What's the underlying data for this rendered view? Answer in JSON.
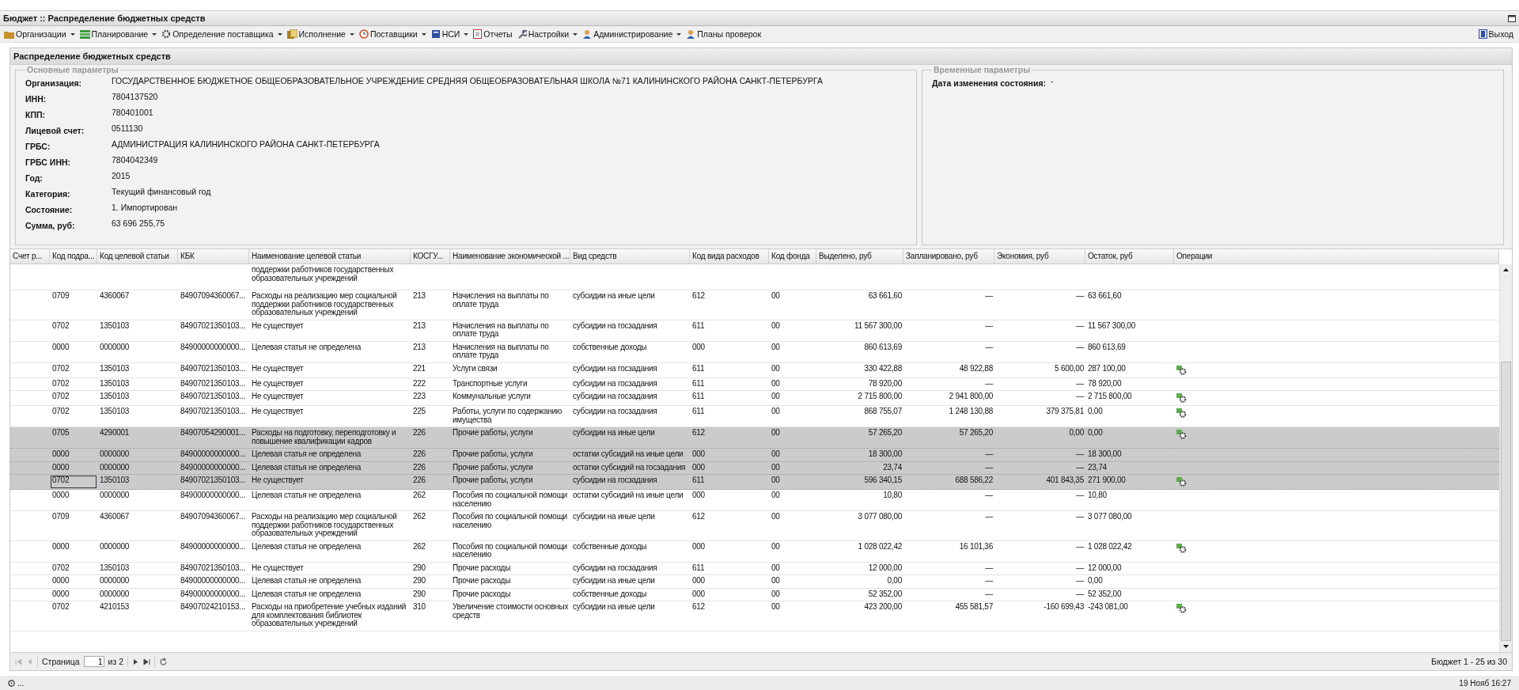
{
  "window": {
    "title": "Бюджет :: Распределение бюджетных средств"
  },
  "toolbar": [
    {
      "label": "Организации",
      "has_menu": true
    },
    {
      "label": "Планирование",
      "has_menu": true
    },
    {
      "label": "Определение поставщика",
      "has_menu": true
    },
    {
      "label": "Исполнение",
      "has_menu": true
    },
    {
      "label": "Поставщики",
      "has_menu": true
    },
    {
      "label": "НСИ",
      "has_menu": true
    },
    {
      "label": "Отчеты",
      "has_menu": false
    },
    {
      "label": "Настройки",
      "has_menu": true
    },
    {
      "label": "Администрирование",
      "has_menu": true
    },
    {
      "label": "Планы проверок",
      "has_menu": false
    }
  ],
  "exit_button": {
    "label": "Выход"
  },
  "panel": {
    "title": "Распределение бюджетных средств"
  },
  "main_params": {
    "legend": "Основные параметры",
    "fields": [
      {
        "label": "Организация:",
        "value": "ГОСУДАРСТВЕННОЕ БЮДЖЕТНОЕ ОБЩЕОБРАЗОВАТЕЛЬНОЕ УЧРЕЖДЕНИЕ СРЕДНЯЯ ОБЩЕОБРАЗОВАТЕЛЬНАЯ ШКОЛА №71 КАЛИНИНСКОГО РАЙОНА САНКТ-ПЕТЕРБУРГА"
      },
      {
        "label": "ИНН:",
        "value": "7804137520"
      },
      {
        "label": "КПП:",
        "value": "780401001"
      },
      {
        "label": "Лицевой счет:",
        "value": "0511130"
      },
      {
        "label": "ГРБС:",
        "value": "АДМИНИСТРАЦИЯ КАЛИНИНСКОГО РАЙОНА САНКТ-ПЕТЕРБУРГА"
      },
      {
        "label": "ГРБС ИНН:",
        "value": "7804042349"
      },
      {
        "label": "Год:",
        "value": "2015"
      },
      {
        "label": "Категория:",
        "value": "Текущий финансовый год"
      },
      {
        "label": "Состояние:",
        "value": "1. Импортирован"
      },
      {
        "label": "Сумма, руб:",
        "value": "63 696 255,75"
      }
    ]
  },
  "time_params": {
    "legend": "Временные параметры",
    "fields": [
      {
        "label": "Дата изменения состояния:",
        "value": "-"
      }
    ]
  },
  "table": {
    "columns": [
      "Счет р...",
      "Код подра...",
      "Код целевой статьи",
      "КБК",
      "Наименование целевой статьи",
      "КОСГУ...",
      "Наименование экономической ...",
      "Вид средств",
      "Код вида расходов",
      "Код фонда",
      "Выделено, руб",
      "Запланировано, руб",
      "Экономия, руб",
      "Остаток, руб",
      "Операции"
    ],
    "rows": [
      {
        "cells": [
          "",
          "",
          "",
          "",
          "поддержки работников государственных образовательных учреждений",
          "",
          "",
          "",
          "",
          "",
          "",
          "",
          "",
          "",
          ""
        ],
        "has_operation": false,
        "selected": false,
        "focused": false
      },
      {
        "cells": [
          "",
          "0709",
          "4360067",
          "84907094360067...",
          "Расходы на реализацию мер социальной поддержки работников государственных образовательных учреждений",
          "213",
          "Начисления на выплаты по оплате труда",
          "субсидии на иные цели",
          "612",
          "00",
          "63 661,60",
          "—",
          "—",
          "63 661,60"
        ],
        "has_operation": false,
        "selected": false,
        "focused": false
      },
      {
        "cells": [
          "",
          "0702",
          "1350103",
          "84907021350103...",
          "Не существует",
          "213",
          "Начисления на выплаты по оплате труда",
          "субсидии на госзадания",
          "611",
          "00",
          "11 567 300,00",
          "—",
          "—",
          "11 567 300,00"
        ],
        "has_operation": false,
        "selected": false,
        "focused": false
      },
      {
        "cells": [
          "",
          "0000",
          "0000000",
          "84900000000000...",
          "Целевая статья не определена",
          "213",
          "Начисления на выплаты по оплате труда",
          "собственные доходы",
          "000",
          "00",
          "860 613,69",
          "—",
          "—",
          "860 613,69"
        ],
        "has_operation": false,
        "selected": false,
        "focused": false
      },
      {
        "cells": [
          "",
          "0702",
          "1350103",
          "84907021350103...",
          "Не существует",
          "221",
          "Услуги связи",
          "субсидии на госзадания",
          "611",
          "00",
          "330 422,88",
          "48 922,88",
          "5 600,00",
          "287 100,00"
        ],
        "has_operation": true,
        "selected": false,
        "focused": false
      },
      {
        "cells": [
          "",
          "0702",
          "1350103",
          "84907021350103...",
          "Не существует",
          "222",
          "Транспортные услуги",
          "субсидии на госзадания",
          "611",
          "00",
          "78 920,00",
          "—",
          "—",
          "78 920,00"
        ],
        "has_operation": false,
        "selected": false,
        "focused": false
      },
      {
        "cells": [
          "",
          "0702",
          "1350103",
          "84907021350103...",
          "Не существует",
          "223",
          "Коммунальные услуги",
          "субсидии на госзадания",
          "611",
          "00",
          "2 715 800,00",
          "2 941 800,00",
          "—",
          "2 715 800,00"
        ],
        "has_operation": true,
        "selected": false,
        "focused": false
      },
      {
        "cells": [
          "",
          "0702",
          "1350103",
          "84907021350103...",
          "Не существует",
          "225",
          "Работы, услуги по содержанию имущества",
          "субсидии на госзадания",
          "611",
          "00",
          "868 755,07",
          "1 248 130,88",
          "379 375,81",
          "0,00"
        ],
        "has_operation": true,
        "selected": false,
        "focused": false
      },
      {
        "cells": [
          "",
          "0705",
          "4290001",
          "84907054290001...",
          "Расходы на подготовку, переподготовку и повышение квалификации кадров",
          "226",
          "Прочие работы, услуги",
          "субсидии на иные цели",
          "612",
          "00",
          "57 265,20",
          "57 265,20",
          "0,00",
          "0,00"
        ],
        "has_operation": true,
        "selected": true,
        "focused": false
      },
      {
        "cells": [
          "",
          "0000",
          "0000000",
          "84900000000000...",
          "Целевая статья не определена",
          "226",
          "Прочие работы, услуги",
          "остатки субсидий на иные цели",
          "000",
          "00",
          "18 300,00",
          "—",
          "—",
          "18 300,00"
        ],
        "has_operation": false,
        "selected": true,
        "focused": false
      },
      {
        "cells": [
          "",
          "0000",
          "0000000",
          "84900000000000...",
          "Целевая статья не определена",
          "226",
          "Прочие работы, услуги",
          "остатки субсидий на госзадания",
          "000",
          "00",
          "23,74",
          "—",
          "—",
          "23,74"
        ],
        "has_operation": false,
        "selected": true,
        "focused": false
      },
      {
        "cells": [
          "",
          "0702",
          "1350103",
          "84907021350103...",
          "Не существует",
          "226",
          "Прочие работы, услуги",
          "субсидии на госзадания",
          "611",
          "00",
          "596 340,15",
          "688 586,22",
          "401 843,35",
          "271 900,00"
        ],
        "has_operation": true,
        "selected": true,
        "focused": true
      },
      {
        "cells": [
          "",
          "0000",
          "0000000",
          "84900000000000...",
          "Целевая статья не определена",
          "262",
          "Пособия по социальной помощи населению",
          "остатки субсидий на иные цели",
          "000",
          "00",
          "10,80",
          "—",
          "—",
          "10,80"
        ],
        "has_operation": false,
        "selected": false,
        "focused": false
      },
      {
        "cells": [
          "",
          "0709",
          "4360067",
          "84907094360067...",
          "Расходы на реализацию мер социальной поддержки работников государственных образовательных учреждений",
          "262",
          "Пособия по социальной помощи населению",
          "субсидии на иные цели",
          "612",
          "00",
          "3 077 080,00",
          "—",
          "—",
          "3 077 080,00"
        ],
        "has_operation": false,
        "selected": false,
        "focused": false
      },
      {
        "cells": [
          "",
          "0000",
          "0000000",
          "84900000000000...",
          "Целевая статья не определена",
          "262",
          "Пособия по социальной помощи населению",
          "собственные доходы",
          "000",
          "00",
          "1 028 022,42",
          "16 101,36",
          "—",
          "1 028 022,42"
        ],
        "has_operation": true,
        "selected": false,
        "focused": false
      },
      {
        "cells": [
          "",
          "0702",
          "1350103",
          "84907021350103...",
          "Не существует",
          "290",
          "Прочие расходы",
          "субсидии на госзадания",
          "611",
          "00",
          "12 000,00",
          "—",
          "—",
          "12 000,00"
        ],
        "has_operation": false,
        "selected": false,
        "focused": false
      },
      {
        "cells": [
          "",
          "0000",
          "0000000",
          "84900000000000...",
          "Целевая статья не определена",
          "290",
          "Прочие расходы",
          "субсидии на иные цели",
          "000",
          "00",
          "0,00",
          "—",
          "—",
          "0,00"
        ],
        "has_operation": false,
        "selected": false,
        "focused": false
      },
      {
        "cells": [
          "",
          "0000",
          "0000000",
          "84900000000000...",
          "Целевая статья не определена",
          "290",
          "Прочие расходы",
          "собственные доходы",
          "000",
          "00",
          "52 352,00",
          "—",
          "—",
          "52 352,00"
        ],
        "has_operation": false,
        "selected": false,
        "focused": false
      },
      {
        "cells": [
          "",
          "0702",
          "4210153",
          "84907024210153...",
          "Расходы на приобретение учебных изданий для комплектования библиотек образовательных учреждений",
          "310",
          "Увеличение стоимости основных средств",
          "субсидии на иные цели",
          "612",
          "00",
          "423 200,00",
          "455 581,57",
          "-160 699,43",
          "-243 081,00"
        ],
        "has_operation": true,
        "selected": false,
        "focused": false
      }
    ]
  },
  "pager": {
    "page_label": "Страница",
    "page_value": "1",
    "of_label": "из 2",
    "summary": "Бюджет 1 - 25 из 30"
  },
  "status_bar": {
    "left": "...",
    "right": "19 Нояб 16:27"
  }
}
